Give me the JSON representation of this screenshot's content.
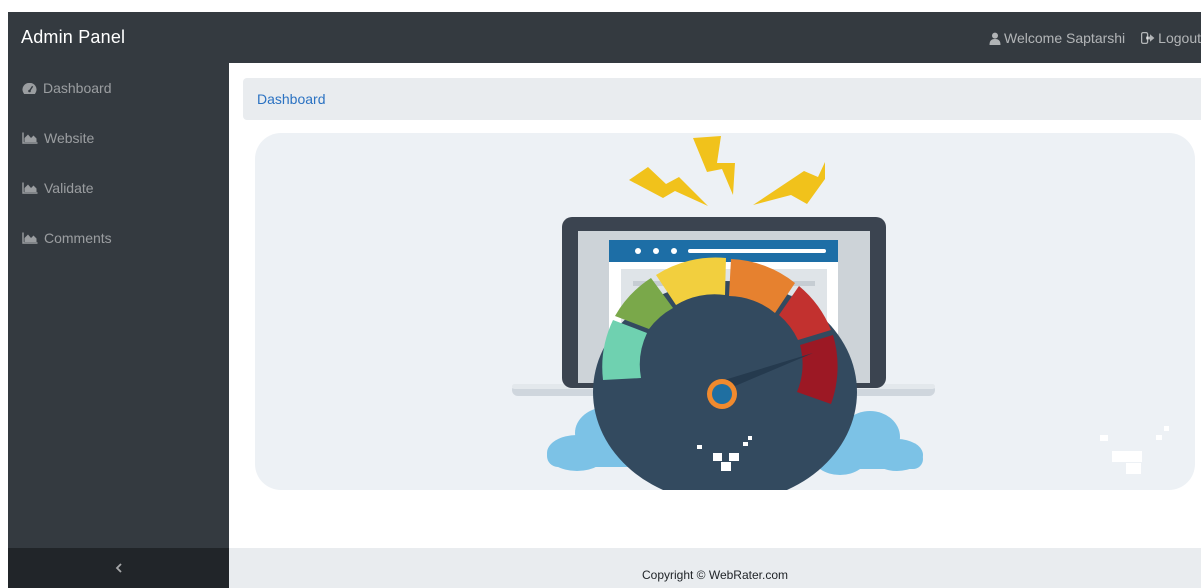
{
  "navbar": {
    "brand": "Admin Panel",
    "welcome": "Welcome Saptarshi",
    "logout": "Logout"
  },
  "sidebar": {
    "items": [
      {
        "label": "Dashboard",
        "icon": "tachometer-icon"
      },
      {
        "label": "Website",
        "icon": "area-chart-icon"
      },
      {
        "label": "Validate",
        "icon": "area-chart-icon"
      },
      {
        "label": "Comments",
        "icon": "area-chart-icon"
      }
    ],
    "toggle_icon": "chevron-left-icon"
  },
  "breadcrumb": {
    "current": "Dashboard"
  },
  "footer": {
    "copyright": "Copyright © WebRater.com"
  },
  "colors": {
    "navbar_bg": "#343a40",
    "sidebar_bg": "#343a40",
    "toggle_bg": "#212529",
    "breadcrumb_bg": "#e9ecef",
    "link": "#2b72c2"
  }
}
